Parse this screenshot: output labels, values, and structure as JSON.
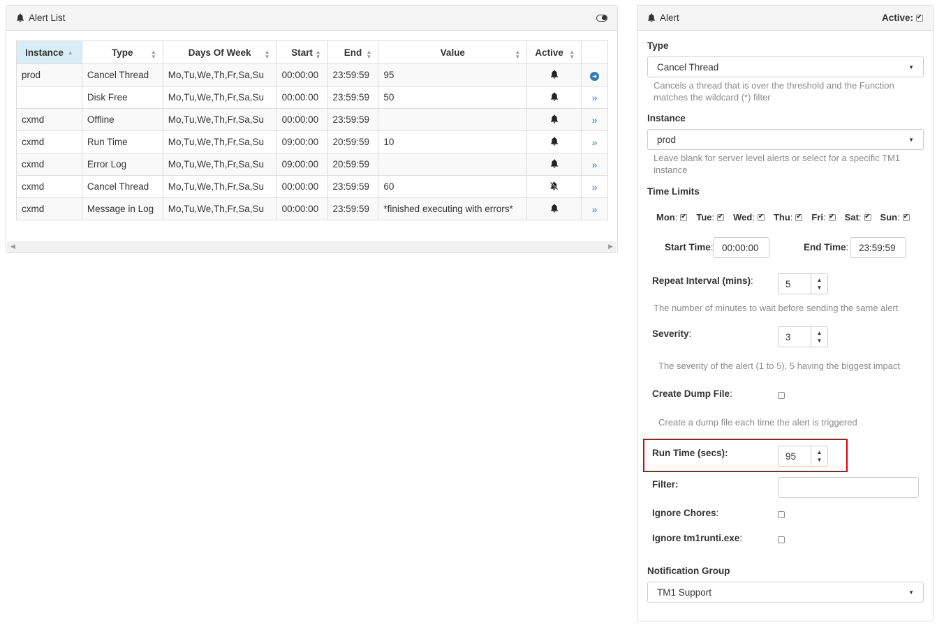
{
  "alert_list": {
    "title": "Alert List",
    "columns": [
      "Instance",
      "Type",
      "Days Of Week",
      "Start",
      "End",
      "Value",
      "Active"
    ],
    "rows": [
      {
        "instance": "prod",
        "type": "Cancel Thread",
        "days": "Mo,Tu,We,Th,Fr,Sa,Su",
        "start": "00:00:00",
        "end": "23:59:59",
        "value": "95",
        "active": "bell-icon",
        "action": "arrow-circle-right-icon"
      },
      {
        "instance": "",
        "type": "Disk Free",
        "days": "Mo,Tu,We,Th,Fr,Sa,Su",
        "start": "00:00:00",
        "end": "23:59:59",
        "value": "50",
        "active": "bell-icon",
        "action": "double-chevron-right-icon"
      },
      {
        "instance": "cxmd",
        "type": "Offline",
        "days": "Mo,Tu,We,Th,Fr,Sa,Su",
        "start": "00:00:00",
        "end": "23:59:59",
        "value": "",
        "active": "bell-icon",
        "action": "double-chevron-right-icon"
      },
      {
        "instance": "cxmd",
        "type": "Run Time",
        "days": "Mo,Tu,We,Th,Fr,Sa,Su",
        "start": "09:00:00",
        "end": "20:59:59",
        "value": "10",
        "active": "bell-icon",
        "action": "double-chevron-right-icon"
      },
      {
        "instance": "cxmd",
        "type": "Error Log",
        "days": "Mo,Tu,We,Th,Fr,Sa,Su",
        "start": "09:00:00",
        "end": "20:59:59",
        "value": "",
        "active": "bell-icon",
        "action": "double-chevron-right-icon"
      },
      {
        "instance": "cxmd",
        "type": "Cancel Thread",
        "days": "Mo,Tu,We,Th,Fr,Sa,Su",
        "start": "00:00:00",
        "end": "23:59:59",
        "value": "60",
        "active": "bell-slash-icon",
        "action": "double-chevron-right-icon"
      },
      {
        "instance": "cxmd",
        "type": "Message in Log",
        "days": "Mo,Tu,We,Th,Fr,Sa,Su",
        "start": "00:00:00",
        "end": "23:59:59",
        "value": "*finished executing with errors*",
        "active": "bell-icon",
        "action": "double-chevron-right-icon"
      }
    ]
  },
  "alert_form": {
    "title": "Alert",
    "active_label": "Active:",
    "active_checked": true,
    "type_label": "Type",
    "type_value": "Cancel Thread",
    "type_help": "Cancels a thread that is over the threshold and the Function matches the wildcard (*) filter",
    "instance_label": "Instance",
    "instance_value": "prod",
    "instance_help": "Leave blank for server level alerts or select for a specific TM1 instance",
    "time_limits_label": "Time Limits",
    "days": [
      {
        "label": "Mon",
        "checked": true
      },
      {
        "label": "Tue",
        "checked": true
      },
      {
        "label": "Wed",
        "checked": true
      },
      {
        "label": "Thu",
        "checked": true
      },
      {
        "label": "Fri",
        "checked": true
      },
      {
        "label": "Sat",
        "checked": true
      },
      {
        "label": "Sun",
        "checked": true
      }
    ],
    "start_time_label": "Start Time",
    "start_time": "00:00:00",
    "end_time_label": "End Time",
    "end_time": "23:59:59",
    "repeat_label": "Repeat Interval (mins)",
    "repeat_value": "5",
    "repeat_help": "The number of minutes to wait before sending the same alert",
    "severity_label": "Severity",
    "severity_value": "3",
    "severity_help": "The severity of the alert (1 to 5), 5 having the biggest impact",
    "dump_label": "Create Dump File",
    "dump_checked": false,
    "dump_help": "Create a dump file each time the alert is triggered",
    "runtime_label": "Run Time (secs):",
    "runtime_value": "95",
    "filter_label": "Filter:",
    "filter_value": "",
    "ignore_chores_label": "Ignore Chores",
    "ignore_chores_checked": false,
    "ignore_runti_label": "Ignore tm1runti.exe",
    "ignore_runti_checked": false,
    "notification_label": "Notification Group",
    "notification_value": "TM1 Support"
  },
  "colors": {
    "accent": "#337ab7",
    "sorted_header": "#d9edf7",
    "highlight_box": "#e00000",
    "help_text": "#8a8a8a"
  }
}
